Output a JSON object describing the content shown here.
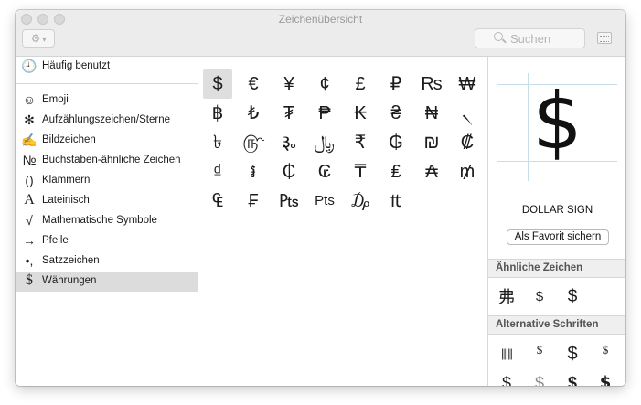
{
  "window": {
    "title": "Zeichenübersicht"
  },
  "toolbar": {
    "gear_icon": "gear-icon",
    "search_placeholder": "Suchen"
  },
  "sidebar": {
    "items": [
      {
        "icon": "🕘",
        "label": "Häufig benutzt"
      },
      {
        "icon": "☺",
        "label": "Emoji"
      },
      {
        "icon": "✻",
        "label": "Aufzählungszeichen/Sterne"
      },
      {
        "icon": "✍",
        "label": "Bildzeichen"
      },
      {
        "icon": "№",
        "label": "Buchstaben-ähnliche Zeichen"
      },
      {
        "icon": "()",
        "label": "Klammern"
      },
      {
        "icon": "A",
        "label": "Lateinisch"
      },
      {
        "icon": "√",
        "label": "Mathematische Symbole"
      },
      {
        "icon": "→",
        "label": "Pfeile"
      },
      {
        "icon": "•,",
        "label": "Satzzeichen"
      },
      {
        "icon": "$",
        "label": "Währungen"
      }
    ],
    "selected": "Währungen"
  },
  "grid": {
    "chars": [
      "$",
      "€",
      "¥",
      "¢",
      "£",
      "₽",
      "₨",
      "₩",
      "฿",
      "₺",
      "₮",
      "₱",
      "₭",
      "₴",
      "₦",
      "৲",
      "৳",
      "௹",
      "૱",
      "﷼",
      "₹",
      "₲",
      "₪",
      "₡",
      "₫",
      "៛",
      "₵",
      "₢",
      "₸",
      "₤",
      "₳",
      "₥",
      "₠",
      "₣",
      "₧",
      "Pts",
      "₯",
      "₶"
    ],
    "selected_index": 0
  },
  "detail": {
    "glyph": "$",
    "name": "DOLLAR SIGN",
    "favorite_button": "Als Favorit sichern",
    "similar_heading": "Ähnliche Zeichen",
    "similar": [
      "弗",
      "$",
      "$"
    ],
    "alt_heading": "Alternative Schriften",
    "alt_fonts": [
      "|||||",
      "$",
      "$",
      "$",
      "$",
      "$",
      "$",
      "$"
    ]
  }
}
